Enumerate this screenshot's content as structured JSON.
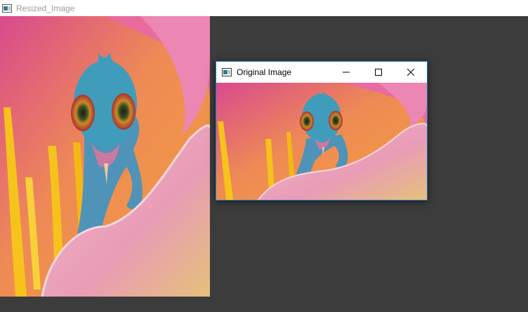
{
  "background_window": {
    "title": "Resized_Image",
    "icon": "opencv-window-icon"
  },
  "foreground_window": {
    "title": "Original Image",
    "icon": "opencv-window-icon",
    "buttons": {
      "minimize": "minimize-icon",
      "maximize": "maximize-icon",
      "close": "close-icon"
    }
  },
  "image": {
    "subject": "chameleon-on-flower",
    "colors": {
      "petal_pink": "#e76aa3",
      "petal_light": "#f1b7c9",
      "stamen_yellow": "#f6c21c",
      "chameleon_blue": "#4f93b8",
      "eye_ring": "#c9892a",
      "backdrop_orange": "#ee8a55"
    }
  },
  "colors": {
    "desktop_bg": "#3c3c3c",
    "active_border": "#1b7cd0",
    "inactive_title_text": "#9a9a9a"
  }
}
